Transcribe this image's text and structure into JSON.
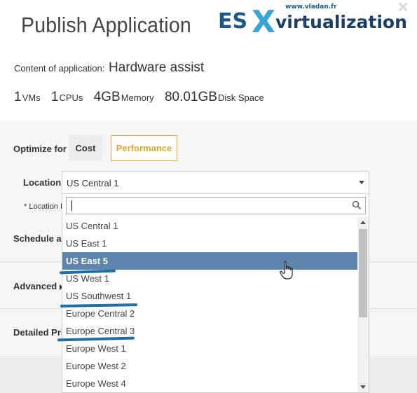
{
  "dialog": {
    "title": "Publish Application",
    "close_icon": "close-icon"
  },
  "logo": {
    "site": "www.vladan.fr",
    "wordmark_es": "ES",
    "wordmark_x": "X",
    "wordmark_rest": "virtualization",
    "colors": {
      "es": "#1b5a8a",
      "x": "#3aa3d6",
      "text": "#1b3f6b"
    }
  },
  "content": {
    "prefix": "Content of application:",
    "value": "Hardware assist"
  },
  "resources": [
    {
      "value": "1",
      "unit": "VMs"
    },
    {
      "value": "1",
      "unit": "CPUs"
    },
    {
      "value": "4GB",
      "unit": "Memory"
    },
    {
      "value": "80.01GB",
      "unit": "Disk Space"
    }
  ],
  "optimize": {
    "label": "Optimize for",
    "cost_label": "Cost",
    "performance_label": "Performance",
    "selected": "Performance",
    "accent_color": "#f0a830"
  },
  "location": {
    "label": "Location",
    "selected_value": "US Central 1",
    "detail_label": "* Location I",
    "search_value": "",
    "search_icon": "search-icon"
  },
  "rows": {
    "schedule_label": "Schedule ap",
    "advanced_label": "Advanced",
    "detailed_label": "Detailed Pri"
  },
  "dropdown": {
    "highlighted": "US East 5",
    "highlight_color": "#5e85ad",
    "options": [
      "US Central 1",
      "US East 1",
      "US East 5",
      "US West 1",
      "US Southwest 1",
      "Europe Central 2",
      "Europe Central 3",
      "Europe West 1",
      "Europe West 2",
      "Europe West 4"
    ],
    "underlined": [
      "US East 5",
      "US Southwest 1",
      "Europe Central 3"
    ],
    "annotation_color": "#1f6ea8"
  },
  "pointer": "hand-cursor-icon"
}
